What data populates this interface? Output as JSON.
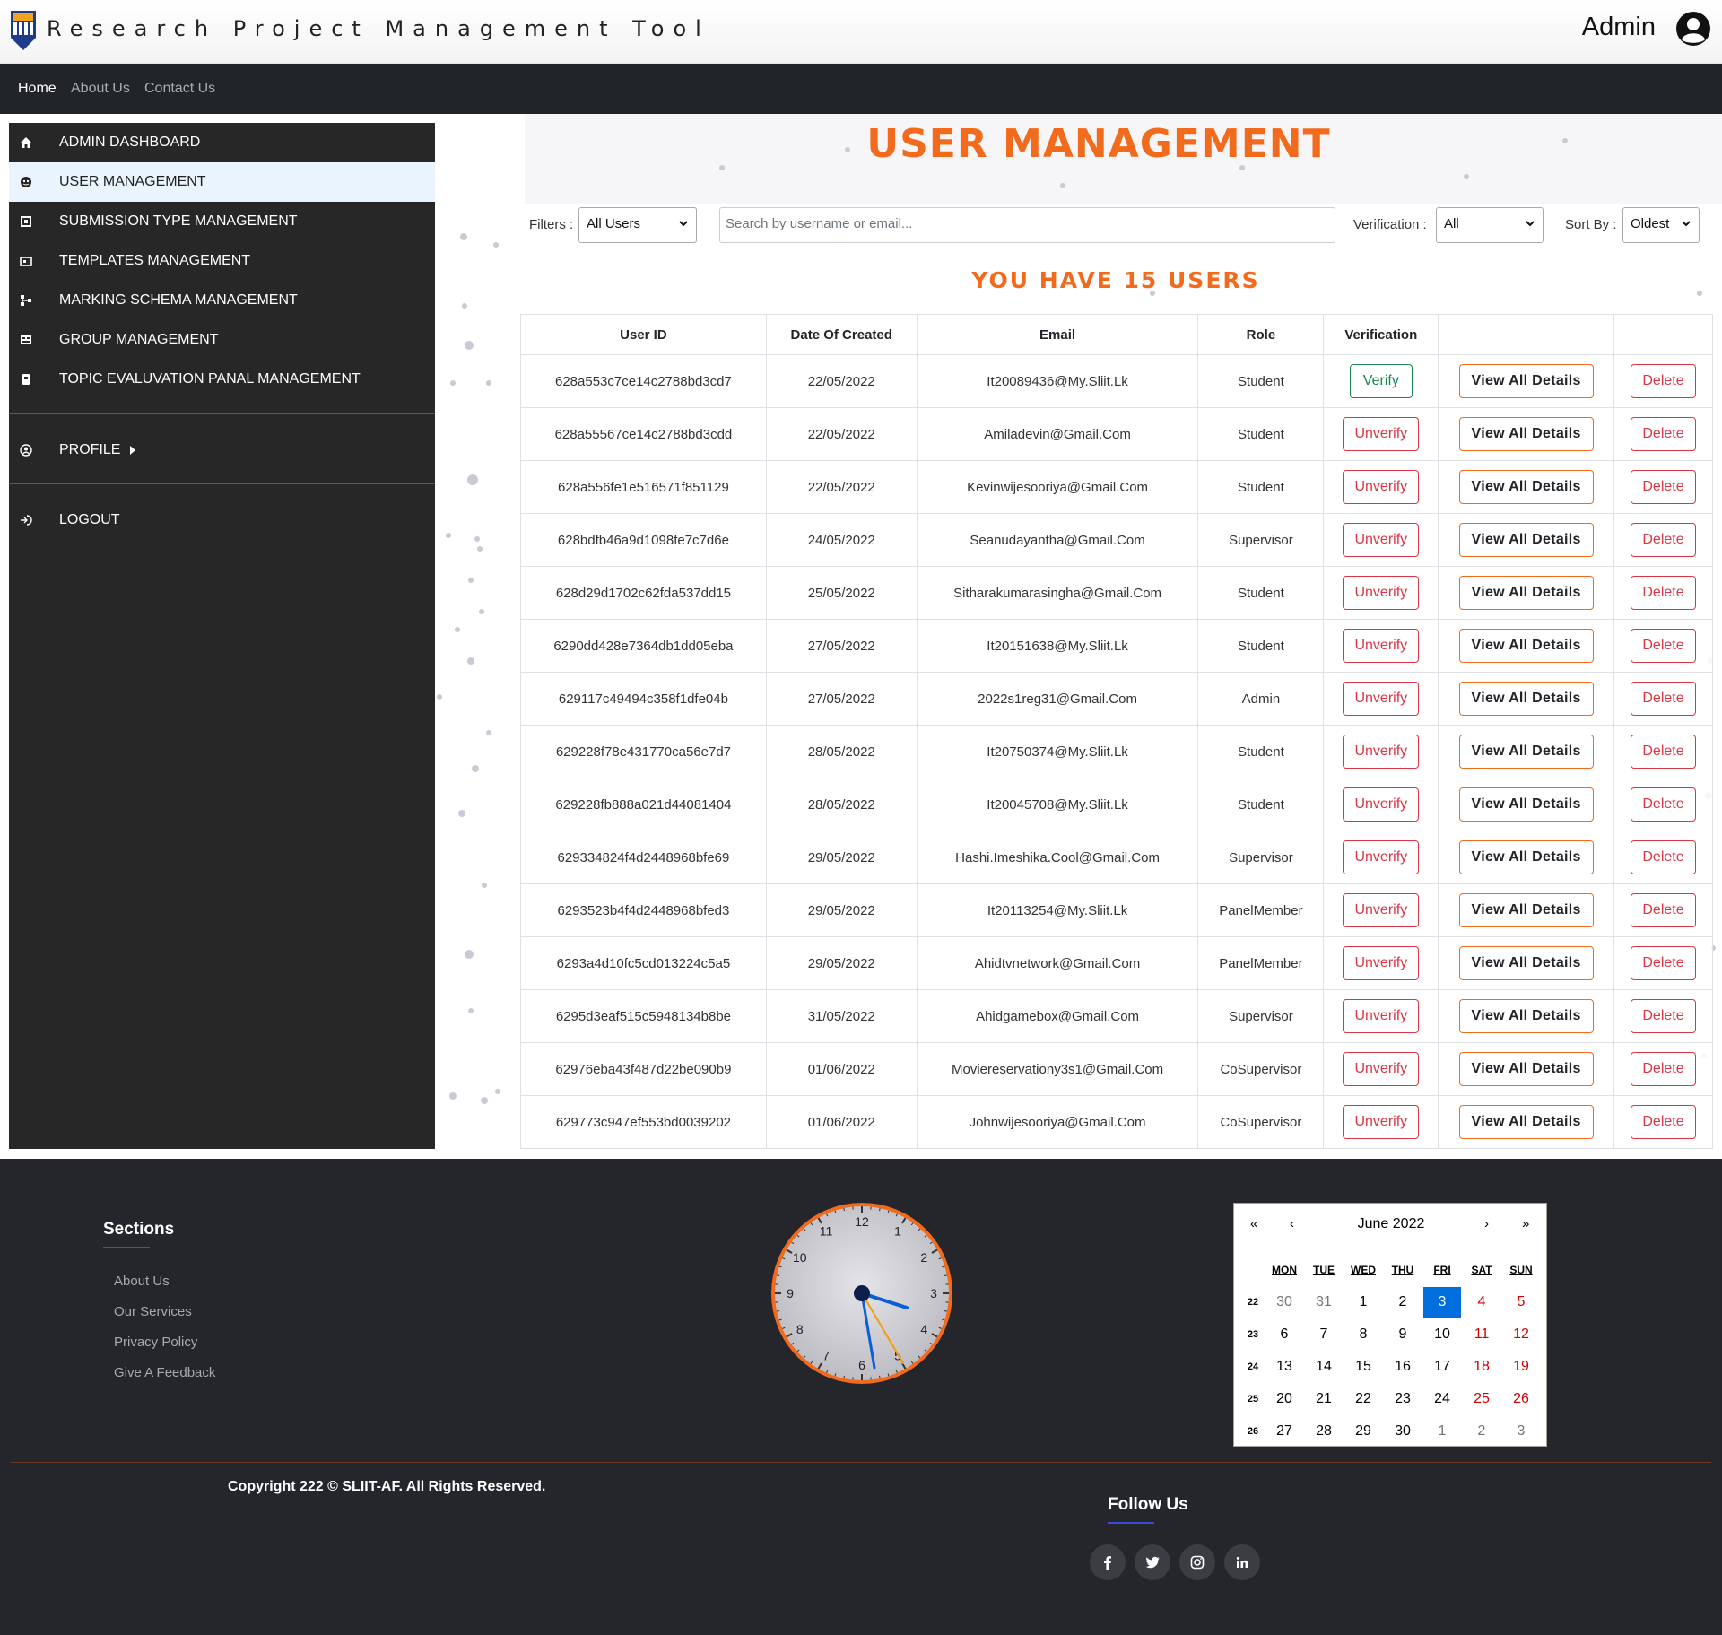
{
  "header": {
    "app_title": "Research Project Management Tool",
    "user_name": "Admin"
  },
  "navbar": {
    "items": [
      {
        "label": "Home",
        "active": true
      },
      {
        "label": "About Us",
        "active": false
      },
      {
        "label": "Contact Us",
        "active": false
      }
    ]
  },
  "sidebar": {
    "items": [
      {
        "label": "ADMIN DASHBOARD",
        "icon": "home-icon"
      },
      {
        "label": "USER MANAGEMENT",
        "icon": "user-circle-icon",
        "active": true
      },
      {
        "label": "SUBMISSION TYPE MANAGEMENT",
        "icon": "submission-icon"
      },
      {
        "label": "TEMPLATES MANAGEMENT",
        "icon": "template-icon"
      },
      {
        "label": "MARKING SCHEMA MANAGEMENT",
        "icon": "hierarchy-icon"
      },
      {
        "label": "GROUP MANAGEMENT",
        "icon": "group-icon"
      },
      {
        "label": "TOPIC EVALUVATION PANAL MANAGEMENT",
        "icon": "panel-icon"
      }
    ],
    "profile_label": "PROFILE",
    "logout_label": "LOGOUT"
  },
  "main": {
    "title": "USER MANAGEMENT",
    "filters_label": "Filters :",
    "filter_value": "All Users",
    "search_placeholder": "Search by username or email...",
    "verification_label": "Verification :",
    "verification_value": "All",
    "sort_label": "Sort By :",
    "sort_value": "Oldest",
    "user_count_text": "YOU HAVE 15 USERS",
    "columns": [
      "User ID",
      "Date Of Created",
      "Email",
      "Role",
      "Verification",
      "",
      ""
    ],
    "button_labels": {
      "verify": "Verify",
      "unverify": "Unverify",
      "view": "View All Details",
      "delete": "Delete"
    },
    "rows": [
      {
        "id": "628a553c7ce14c2788bd3cd7",
        "date": "22/05/2022",
        "email": "It20089436@My.Sliit.Lk",
        "role": "Student",
        "verified": false
      },
      {
        "id": "628a55567ce14c2788bd3cdd",
        "date": "22/05/2022",
        "email": "Amiladevin@Gmail.Com",
        "role": "Student",
        "verified": true
      },
      {
        "id": "628a556fe1e516571f851129",
        "date": "22/05/2022",
        "email": "Kevinwijesooriya@Gmail.Com",
        "role": "Student",
        "verified": true
      },
      {
        "id": "628bdfb46a9d1098fe7c7d6e",
        "date": "24/05/2022",
        "email": "Seanudayantha@Gmail.Com",
        "role": "Supervisor",
        "verified": true
      },
      {
        "id": "628d29d1702c62fda537dd15",
        "date": "25/05/2022",
        "email": "Sitharakumarasingha@Gmail.Com",
        "role": "Student",
        "verified": true
      },
      {
        "id": "6290dd428e7364db1dd05eba",
        "date": "27/05/2022",
        "email": "It20151638@My.Sliit.Lk",
        "role": "Student",
        "verified": true
      },
      {
        "id": "629117c49494c358f1dfe04b",
        "date": "27/05/2022",
        "email": "2022s1reg31@Gmail.Com",
        "role": "Admin",
        "verified": true
      },
      {
        "id": "629228f78e431770ca56e7d7",
        "date": "28/05/2022",
        "email": "It20750374@My.Sliit.Lk",
        "role": "Student",
        "verified": true
      },
      {
        "id": "629228fb888a021d44081404",
        "date": "28/05/2022",
        "email": "It20045708@My.Sliit.Lk",
        "role": "Student",
        "verified": true
      },
      {
        "id": "629334824f4d2448968bfe69",
        "date": "29/05/2022",
        "email": "Hashi.Imeshika.Cool@Gmail.Com",
        "role": "Supervisor",
        "verified": true
      },
      {
        "id": "6293523b4f4d2448968bfed3",
        "date": "29/05/2022",
        "email": "It20113254@My.Sliit.Lk",
        "role": "PanelMember",
        "verified": true
      },
      {
        "id": "6293a4d10fc5cd013224c5a5",
        "date": "29/05/2022",
        "email": "Ahidtvnetwork@Gmail.Com",
        "role": "PanelMember",
        "verified": true
      },
      {
        "id": "6295d3eaf515c5948134b8be",
        "date": "31/05/2022",
        "email": "Ahidgamebox@Gmail.Com",
        "role": "Supervisor",
        "verified": true
      },
      {
        "id": "62976eba43f487d22be090b9",
        "date": "01/06/2022",
        "email": "Moviereservationy3s1@Gmail.Com",
        "role": "CoSupervisor",
        "verified": true
      },
      {
        "id": "629773c947ef553bd0039202",
        "date": "01/06/2022",
        "email": "Johnwijesooriya@Gmail.Com",
        "role": "CoSupervisor",
        "verified": true
      }
    ]
  },
  "footer": {
    "sections_title": "Sections",
    "section_links": [
      "About Us",
      "Our Services",
      "Privacy Policy",
      "Give A Feedback"
    ],
    "clock_numbers": [
      "12",
      "1",
      "2",
      "3",
      "4",
      "5",
      "6",
      "7",
      "8",
      "9",
      "10",
      "11"
    ],
    "calendar": {
      "nav": [
        "«",
        "‹",
        "›",
        "»"
      ],
      "month": "June 2022",
      "weekdays": [
        "MON",
        "TUE",
        "WED",
        "THU",
        "FRI",
        "SAT",
        "SUN"
      ],
      "weeks": [
        {
          "wk": "22",
          "days": [
            "30",
            "31",
            "1",
            "2",
            "3",
            "4",
            "5"
          ]
        },
        {
          "wk": "23",
          "days": [
            "6",
            "7",
            "8",
            "9",
            "10",
            "11",
            "12"
          ]
        },
        {
          "wk": "24",
          "days": [
            "13",
            "14",
            "15",
            "16",
            "17",
            "18",
            "19"
          ]
        },
        {
          "wk": "25",
          "days": [
            "20",
            "21",
            "22",
            "23",
            "24",
            "25",
            "26"
          ]
        },
        {
          "wk": "26",
          "days": [
            "27",
            "28",
            "29",
            "30",
            "1",
            "2",
            "3"
          ]
        }
      ],
      "today": "3"
    },
    "copyright": "Copyright 222 © SLIIT-AF. All Rights Reserved.",
    "follow_title": "Follow Us",
    "social": [
      "facebook-icon",
      "twitter-icon",
      "instagram-icon",
      "linkedin-icon"
    ],
    "colors": {
      "accent": "#f26b1d",
      "footer_bg": "#25262b",
      "today": "#006edc"
    }
  }
}
